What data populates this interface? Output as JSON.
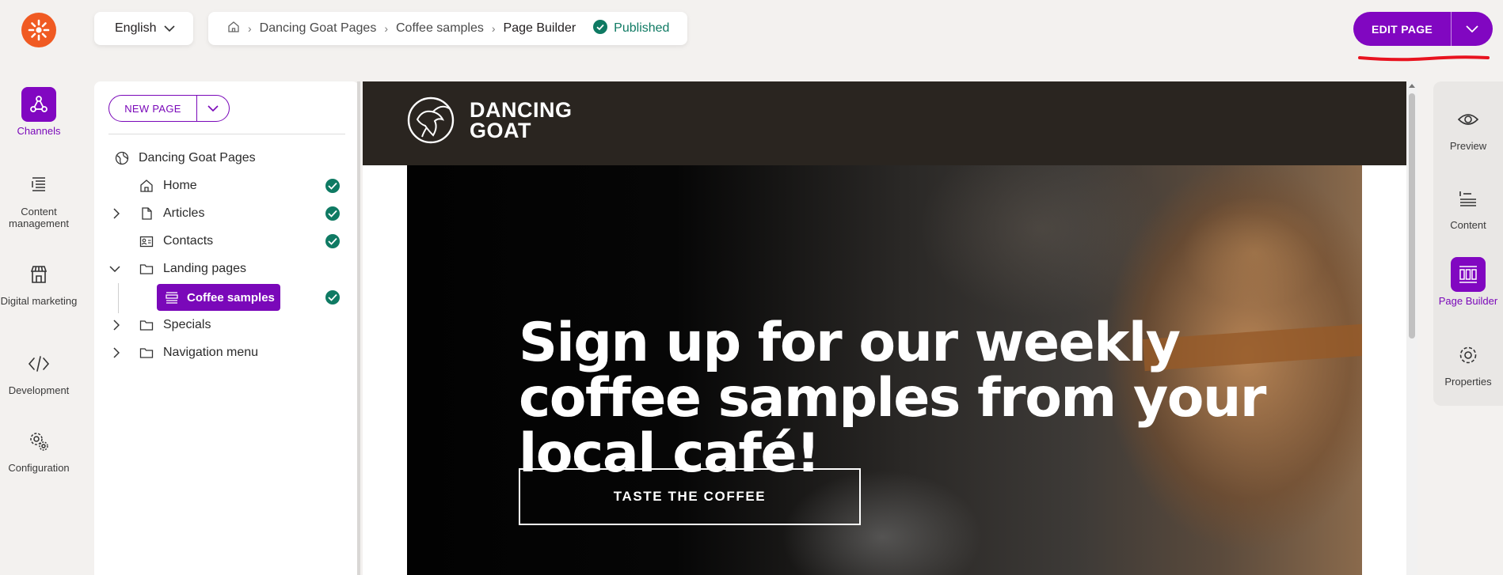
{
  "language": {
    "selected": "English"
  },
  "breadcrumb": {
    "items": [
      "Dancing Goat Pages",
      "Coffee samples",
      "Page Builder"
    ],
    "status": "Published"
  },
  "actions": {
    "edit_label": "EDIT PAGE"
  },
  "left_nav": {
    "items": [
      {
        "label": "Channels",
        "icon": "channels-icon",
        "active": true
      },
      {
        "label": "Content management",
        "icon": "content-management-icon"
      },
      {
        "label": "Digital marketing",
        "icon": "digital-marketing-icon"
      },
      {
        "label": "Development",
        "icon": "development-icon"
      },
      {
        "label": "Configuration",
        "icon": "configuration-icon"
      }
    ]
  },
  "tree": {
    "new_page_label": "NEW PAGE",
    "root": "Dancing Goat Pages",
    "nodes": [
      {
        "label": "Home",
        "published": true
      },
      {
        "label": "Articles",
        "published": true,
        "collapsed": true
      },
      {
        "label": "Contacts",
        "published": true
      },
      {
        "label": "Landing pages",
        "expanded": true
      },
      {
        "label": "Coffee samples",
        "published": true,
        "selected": true
      },
      {
        "label": "Specials",
        "collapsed": true
      },
      {
        "label": "Navigation menu",
        "collapsed": true
      }
    ]
  },
  "preview": {
    "brand_line1": "DANCING",
    "brand_line2": "GOAT",
    "hero_title": "Sign up for our weekly coffee samples from your local café!",
    "hero_button": "TASTE THE COFFEE"
  },
  "right_nav": {
    "items": [
      {
        "label": "Preview",
        "icon": "eye-icon"
      },
      {
        "label": "Content",
        "icon": "content-icon"
      },
      {
        "label": "Page Builder",
        "icon": "page-builder-icon",
        "active": true
      },
      {
        "label": "Properties",
        "icon": "gear-icon"
      }
    ]
  },
  "colors": {
    "accent": "#8107c1",
    "published": "#0f7a63",
    "header_dark": "#2a2520",
    "logo": "#f05a22",
    "annotation": "#e8131f"
  }
}
